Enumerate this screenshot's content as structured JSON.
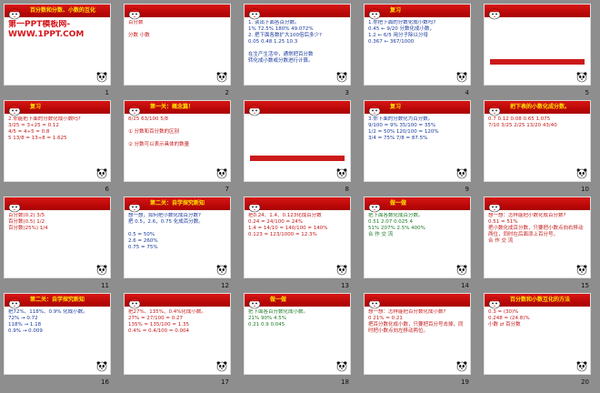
{
  "slides": [
    {
      "number": "1",
      "title": "百分数和分数、小数的互化",
      "text": "第一PPT模板网-WWW.1PPT.COM",
      "style": "big"
    },
    {
      "number": "2",
      "title": "",
      "text": "百分数\n\n分数        小数",
      "style": "red"
    },
    {
      "number": "3",
      "title": "",
      "text": "1. 读出下面各百分数。\n  1%     72.5%    180%    49.072%\n2. 把下面各数扩大100倍后多少?\n  0.05   0.48   1.25   10.3\n\n在生产生活中，通常把百分数\n转化成小数或分数进行计算。",
      "style": ""
    },
    {
      "number": "4",
      "title": "复习",
      "text": "1.你把下面的分数化成小数吗? \n0.45 ← 9/20   分数化成小数，\n1.2 ← 6/5    用分子除以分母\n0.367 ← 367/1000",
      "style": ""
    },
    {
      "number": "5",
      "title": "",
      "text": "",
      "style": ""
    },
    {
      "number": "6",
      "title": "复习",
      "text": "2.你能把下面的分数化成小数吗? \n 3/25 = 3÷25 = 0.12\n 4/5 = 4÷5 = 0.8\n 5 13/8 = 13÷8 = 1.625",
      "style": "red"
    },
    {
      "number": "7",
      "title": "第一关：概念篇！",
      "text": "8/25   63/100   5/8\n\n① 分数和百分数的区别\n\n② 分数可以表示具体的数量",
      "style": "red"
    },
    {
      "number": "8",
      "title": "",
      "text": "",
      "style": ""
    },
    {
      "number": "9",
      "title": "复习",
      "text": "3.你下面的分数化为百分数。\n 9/100 = 9%    35/100 = 35%\n 1/2 = 50%     120/100 = 120%\n 3/4 = 75%     7/8 = 87.5%",
      "style": ""
    },
    {
      "number": "10",
      "title": "把下表的小数化成分数。",
      "text": "0.7  0.12  0.08  0.65  1.075\n7/10  3/25  2/25  13/20  43/40",
      "style": "red"
    },
    {
      "number": "11",
      "title": "",
      "text": "百分数(0.2) 3/5\n百分数(0.5) 1/2\n百分数(25%) 1/4",
      "style": "red"
    },
    {
      "number": "12",
      "title": "第二关：自学探究新知",
      "text": "想一想，如何把小数化成百分数?\n把 0.5，2.6，0.75 化成百分数。\n\n 0.5 = 50%\n 2.6 = 260%\n 0.75 = 75%",
      "style": ""
    },
    {
      "number": "13",
      "title": "",
      "text": "把0.24、1.4、0.123化成百分数\n0.24 = 24/100 = 24%\n1.4 = 14/10 = 140/100 = 140%\n0.123 = 123/1000 = 12.3%",
      "style": "red"
    },
    {
      "number": "14",
      "title": "做一做",
      "text": "把下面各数化成百分数。\n 0.51   2.07   0.025   4\n 51%   207%   2.5%   400%\n合 作 交 流",
      "style": "green"
    },
    {
      "number": "15",
      "title": "",
      "text": "想一想：怎样能把小数化成百分数?\n0.51 = 51%\n把小数化成百分数，只要把小数点向右移动两位，同时在后面添上百分号。\n合 作 交 流",
      "style": "red"
    },
    {
      "number": "16",
      "title": "第二关：自学探究新知",
      "text": "把72%、118%、0.9% 化成小数。\n 72% → 0.72\n 118% → 1.18\n 0.9% → 0.009",
      "style": ""
    },
    {
      "number": "17",
      "title": "",
      "text": "把27%、135%、0.4%化成小数。\n27% = 27/100 = 0.27\n135% = 135/100 = 1.35\n0.4% = 0.4/100 = 0.004",
      "style": "red"
    },
    {
      "number": "18",
      "title": "做一做",
      "text": "把下面各百分数化成小数。\n 21%    90%    4.5%\n 0.21    0.9    0.045",
      "style": "green"
    },
    {
      "number": "19",
      "title": "",
      "text": "想一想：怎样能把百分数化成小数?\n0 21% = 0.21\n把百分数化成小数，只要把百分号去掉，同时把小数点向左移动两位。",
      "style": "red"
    },
    {
      "number": "20",
      "title": "百分数和小数互化的方法",
      "text": "0.3 = (30)%\n0.248 = (24.8)%\n小数 ⇄ 百分数",
      "style": "red"
    }
  ],
  "colors": {
    "header_red": "#c80f0f",
    "title_yellow": "#ffe400",
    "background": "#8e8e8e"
  }
}
